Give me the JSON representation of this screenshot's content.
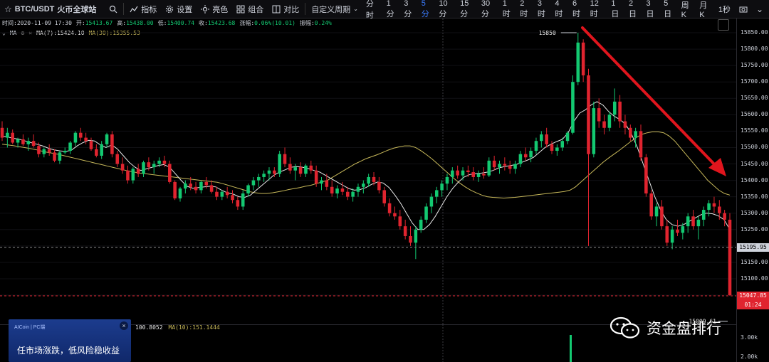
{
  "toolbar": {
    "pair": "BTC/USDT",
    "exchange": "火币全球站",
    "indicator_label": "指标",
    "settings_label": "设置",
    "bright_label": "亮色",
    "combo_label": "组合",
    "compare_label": "对比",
    "custom_period_label": "自定义周期",
    "periods": [
      "分时",
      "1分",
      "3分",
      "5分",
      "10分",
      "15分",
      "30分",
      "1时",
      "2时",
      "3时",
      "4时",
      "6时",
      "12时",
      "1日",
      "2日",
      "3日",
      "5日",
      "周K",
      "月K"
    ],
    "active_period": "5分",
    "refresh_label": "1秒"
  },
  "ohlc": {
    "time_label": "时间:",
    "time": "2020-11-09 17:30",
    "open_label": "开:",
    "open": "15413.67",
    "high_label": "高:",
    "high": "15438.00",
    "low_label": "低:",
    "low": "15400.74",
    "close_label": "收:",
    "close": "15423.68",
    "change_label": "涨幅:",
    "change": "0.06%(10.01)",
    "amplitude_label": "振幅:",
    "amplitude": "0.24%"
  },
  "ma": {
    "label": "MA",
    "ma7_label": "MA(7):",
    "ma7": "15424.10",
    "ma30_label": "MA(30):",
    "ma30": "15355.53"
  },
  "volume": {
    "value": "100.8052",
    "ma10_label": "MA(10):",
    "ma10": "151.1444",
    "axis_labels": [
      "3.00k",
      "2.00k"
    ]
  },
  "markers": {
    "high_label": "15850",
    "low_label": "15009.61",
    "crosshair_price": "15195.95",
    "current_price": "15047.85",
    "countdown": "01:24"
  },
  "ad": {
    "brand": "AICoin | PC端",
    "close": "×",
    "text": "任市场涨跌，低风险稳收益"
  },
  "watermark": {
    "text": "资金盘排行"
  },
  "colors": {
    "up": "#13c971",
    "down": "#e0242f",
    "ma7": "#e8e8e8",
    "ma30": "#c8b95a",
    "arrow": "#e0151d",
    "active": "#3b7cff"
  },
  "chart_data": {
    "type": "candlestick",
    "interval": "5分",
    "ylim": [
      15000,
      15880
    ],
    "y_ticks": [
      15850,
      15800,
      15750,
      15700,
      15650,
      15600,
      15550,
      15500,
      15450,
      15400,
      15350,
      15300,
      15250,
      15200,
      15150,
      15100,
      15050
    ],
    "series_ma7_name": "MA(7)",
    "series_ma30_name": "MA(30)",
    "candles": [
      [
        15560,
        15580,
        15520,
        15530
      ],
      [
        15530,
        15560,
        15500,
        15545
      ],
      [
        15545,
        15555,
        15510,
        15515
      ],
      [
        15515,
        15530,
        15500,
        15525
      ],
      [
        15525,
        15540,
        15505,
        15510
      ],
      [
        15510,
        15530,
        15490,
        15520
      ],
      [
        15520,
        15540,
        15500,
        15505
      ],
      [
        15505,
        15515,
        15470,
        15480
      ],
      [
        15480,
        15500,
        15470,
        15495
      ],
      [
        15495,
        15510,
        15475,
        15485
      ],
      [
        15485,
        15495,
        15455,
        15460
      ],
      [
        15460,
        15490,
        15450,
        15485
      ],
      [
        15485,
        15500,
        15480,
        15490
      ],
      [
        15490,
        15520,
        15480,
        15515
      ],
      [
        15515,
        15550,
        15505,
        15545
      ],
      [
        15545,
        15560,
        15520,
        15530
      ],
      [
        15530,
        15545,
        15510,
        15520
      ],
      [
        15520,
        15530,
        15490,
        15495
      ],
      [
        15495,
        15510,
        15470,
        15475
      ],
      [
        15475,
        15520,
        15465,
        15510
      ],
      [
        15510,
        15545,
        15500,
        15540
      ],
      [
        15540,
        15550,
        15470,
        15480
      ],
      [
        15480,
        15490,
        15440,
        15450
      ],
      [
        15450,
        15470,
        15420,
        15430
      ],
      [
        15430,
        15445,
        15390,
        15400
      ],
      [
        15400,
        15440,
        15390,
        15435
      ],
      [
        15435,
        15450,
        15410,
        15420
      ],
      [
        15420,
        15460,
        15410,
        15455
      ],
      [
        15455,
        15470,
        15430,
        15440
      ],
      [
        15440,
        15460,
        15420,
        15450
      ],
      [
        15450,
        15470,
        15440,
        15460
      ],
      [
        15460,
        15475,
        15440,
        15450
      ],
      [
        15450,
        15460,
        15390,
        15395
      ],
      [
        15395,
        15400,
        15340,
        15345
      ],
      [
        15345,
        15380,
        15335,
        15375
      ],
      [
        15375,
        15400,
        15360,
        15390
      ],
      [
        15390,
        15410,
        15370,
        15380
      ],
      [
        15380,
        15395,
        15360,
        15370
      ],
      [
        15370,
        15400,
        15360,
        15395
      ],
      [
        15395,
        15410,
        15375,
        15385
      ],
      [
        15385,
        15400,
        15360,
        15365
      ],
      [
        15365,
        15380,
        15340,
        15350
      ],
      [
        15350,
        15370,
        15340,
        15365
      ],
      [
        15365,
        15380,
        15345,
        15355
      ],
      [
        15355,
        15370,
        15330,
        15340
      ],
      [
        15340,
        15350,
        15310,
        15320
      ],
      [
        15320,
        15370,
        15310,
        15360
      ],
      [
        15360,
        15390,
        15350,
        15385
      ],
      [
        15385,
        15410,
        15370,
        15400
      ],
      [
        15400,
        15420,
        15380,
        15410
      ],
      [
        15410,
        15430,
        15395,
        15420
      ],
      [
        15420,
        15440,
        15400,
        15430
      ],
      [
        15430,
        15440,
        15410,
        15420
      ],
      [
        15420,
        15490,
        15410,
        15480
      ],
      [
        15480,
        15500,
        15440,
        15450
      ],
      [
        15450,
        15470,
        15420,
        15430
      ],
      [
        15430,
        15450,
        15400,
        15440
      ],
      [
        15440,
        15455,
        15410,
        15420
      ],
      [
        15420,
        15450,
        15410,
        15445
      ],
      [
        15445,
        15460,
        15420,
        15430
      ],
      [
        15430,
        15445,
        15380,
        15390
      ],
      [
        15390,
        15410,
        15370,
        15400
      ],
      [
        15400,
        15420,
        15370,
        15380
      ],
      [
        15380,
        15400,
        15350,
        15360
      ],
      [
        15360,
        15385,
        15345,
        15375
      ],
      [
        15375,
        15395,
        15355,
        15365
      ],
      [
        15365,
        15380,
        15340,
        15350
      ],
      [
        15350,
        15375,
        15335,
        15365
      ],
      [
        15365,
        15390,
        15350,
        15380
      ],
      [
        15380,
        15400,
        15360,
        15390
      ],
      [
        15390,
        15420,
        15380,
        15410
      ],
      [
        15410,
        15425,
        15385,
        15395
      ],
      [
        15395,
        15410,
        15360,
        15370
      ],
      [
        15370,
        15380,
        15320,
        15330
      ],
      [
        15330,
        15345,
        15290,
        15300
      ],
      [
        15300,
        15320,
        15280,
        15290
      ],
      [
        15290,
        15310,
        15250,
        15260
      ],
      [
        15260,
        15280,
        15220,
        15230
      ],
      [
        15230,
        15260,
        15200,
        15210
      ],
      [
        15210,
        15260,
        15160,
        15250
      ],
      [
        15250,
        15290,
        15240,
        15280
      ],
      [
        15280,
        15330,
        15270,
        15320
      ],
      [
        15320,
        15360,
        15300,
        15350
      ],
      [
        15350,
        15380,
        15330,
        15370
      ],
      [
        15370,
        15400,
        15350,
        15390
      ],
      [
        15390,
        15420,
        15370,
        15410
      ],
      [
        15410,
        15440,
        15390,
        15430
      ],
      [
        15430,
        15445,
        15405,
        15415
      ],
      [
        15415,
        15440,
        15400,
        15430
      ],
      [
        15430,
        15445,
        15410,
        15425
      ],
      [
        15425,
        15440,
        15400,
        15410
      ],
      [
        15410,
        15430,
        15395,
        15420
      ],
      [
        15420,
        15440,
        15405,
        15415
      ],
      [
        15415,
        15470,
        15410,
        15460
      ],
      [
        15460,
        15475,
        15430,
        15440
      ],
      [
        15440,
        15460,
        15420,
        15450
      ],
      [
        15450,
        15470,
        15430,
        15445
      ],
      [
        15445,
        15460,
        15420,
        15435
      ],
      [
        15435,
        15460,
        15420,
        15450
      ],
      [
        15450,
        15490,
        15440,
        15480
      ],
      [
        15480,
        15500,
        15460,
        15470
      ],
      [
        15470,
        15500,
        15455,
        15490
      ],
      [
        15490,
        15530,
        15480,
        15520
      ],
      [
        15520,
        15550,
        15500,
        15540
      ],
      [
        15540,
        15560,
        15500,
        15510
      ],
      [
        15510,
        15520,
        15480,
        15490
      ],
      [
        15490,
        15510,
        15475,
        15500
      ],
      [
        15500,
        15530,
        15490,
        15520
      ],
      [
        15520,
        15550,
        15510,
        15545
      ],
      [
        15545,
        15720,
        15540,
        15700
      ],
      [
        15700,
        15850,
        15690,
        15820
      ],
      [
        15820,
        15830,
        15700,
        15720
      ],
      [
        15720,
        15740,
        15200,
        15480
      ],
      [
        15480,
        15640,
        15470,
        15620
      ],
      [
        15620,
        15650,
        15560,
        15580
      ],
      [
        15580,
        15600,
        15540,
        15560
      ],
      [
        15560,
        15610,
        15550,
        15600
      ],
      [
        15600,
        15680,
        15580,
        15640
      ],
      [
        15640,
        15660,
        15560,
        15580
      ],
      [
        15580,
        15600,
        15540,
        15560
      ],
      [
        15560,
        15570,
        15520,
        15530
      ],
      [
        15530,
        15560,
        15500,
        15550
      ],
      [
        15550,
        15570,
        15460,
        15470
      ],
      [
        15470,
        15480,
        15350,
        15360
      ],
      [
        15360,
        15370,
        15280,
        15290
      ],
      [
        15290,
        15330,
        15260,
        15320
      ],
      [
        15320,
        15340,
        15250,
        15260
      ],
      [
        15260,
        15280,
        15200,
        15210
      ],
      [
        15210,
        15260,
        15190,
        15250
      ],
      [
        15250,
        15280,
        15230,
        15240
      ],
      [
        15240,
        15270,
        15220,
        15260
      ],
      [
        15260,
        15300,
        15240,
        15290
      ],
      [
        15290,
        15310,
        15250,
        15260
      ],
      [
        15260,
        15290,
        15220,
        15280
      ],
      [
        15280,
        15320,
        15260,
        15310
      ],
      [
        15310,
        15340,
        15290,
        15330
      ],
      [
        15330,
        15350,
        15300,
        15320
      ],
      [
        15320,
        15340,
        15280,
        15300
      ],
      [
        15300,
        15310,
        15260,
        15280
      ],
      [
        15280,
        15300,
        15048,
        15050
      ]
    ],
    "ma7": [
      15535,
      15532,
      15528,
      15525,
      15520,
      15515,
      15510,
      15505,
      15498,
      15493,
      15490,
      15488,
      15492,
      15505,
      15515,
      15522,
      15520,
      15508,
      15500,
      15508,
      15495,
      15475,
      15455,
      15440,
      15430,
      15435,
      15440,
      15445,
      15448,
      15440,
      15420,
      15400,
      15382,
      15376,
      15378,
      15380,
      15382,
      15380,
      15370,
      15362,
      15358,
      15350,
      15348,
      15355,
      15370,
      15385,
      15400,
      15415,
      15425,
      15432,
      15440,
      15442,
      15440,
      15436,
      15430,
      15425,
      15415,
      15405,
      15395,
      15385,
      15375,
      15370,
      15372,
      15378,
      15388,
      15395,
      15392,
      15378,
      15355,
      15330,
      15300,
      15270,
      15250,
      15250,
      15265,
      15290,
      15320,
      15350,
      15375,
      15395,
      15410,
      15418,
      15420,
      15422,
      15425,
      15430,
      15438,
      15442,
      15445,
      15448,
      15455,
      15462,
      15470,
      15485,
      15500,
      15510,
      15518,
      15525,
      15545,
      15580,
      15605,
      15615,
      15630,
      15640,
      15630,
      15610,
      15595,
      15585,
      15570,
      15540,
      15500,
      15450,
      15400,
      15350,
      15310,
      15280,
      15265,
      15260,
      15265,
      15275,
      15285,
      15295,
      15300,
      15298,
      15292,
      15280,
      15250
    ],
    "ma30": [
      15510,
      15508,
      15506,
      15503,
      15500,
      15497,
      15494,
      15490,
      15486,
      15483,
      15480,
      15476,
      15472,
      15468,
      15464,
      15460,
      15456,
      15452,
      15448,
      15444,
      15440,
      15436,
      15432,
      15428,
      15425,
      15422,
      15420,
      15418,
      15416,
      15414,
      15412,
      15410,
      15408,
      15406,
      15404,
      15402,
      15400,
      15398,
      15396,
      15394,
      15390,
      15385,
      15380,
      15375,
      15370,
      15365,
      15362,
      15360,
      15360,
      15362,
      15365,
      15368,
      15372,
      15375,
      15378,
      15382,
      15385,
      15390,
      15395,
      15400,
      15410,
      15420,
      15430,
      15440,
      15450,
      15458,
      15466,
      15472,
      15478,
      15485,
      15492,
      15498,
      15502,
      15505,
      15505,
      15500,
      15490,
      15478,
      15465,
      15450,
      15435,
      15420,
      15405,
      15392,
      15380,
      15370,
      15362,
      15355,
      15350,
      15348,
      15347,
      15346,
      15347,
      15348,
      15350,
      15352,
      15354,
      15356,
      15358,
      15360,
      15362,
      15364,
      15366,
      15370,
      15380,
      15395,
      15410,
      15425,
      15440,
      15455,
      15468,
      15480,
      15492,
      15505,
      15518,
      15530,
      15540,
      15545,
      15548,
      15548,
      15545,
      15535,
      15520,
      15500,
      15480,
      15460,
      15440,
      15420,
      15400,
      15385,
      15370,
      15360,
      15355
    ]
  }
}
